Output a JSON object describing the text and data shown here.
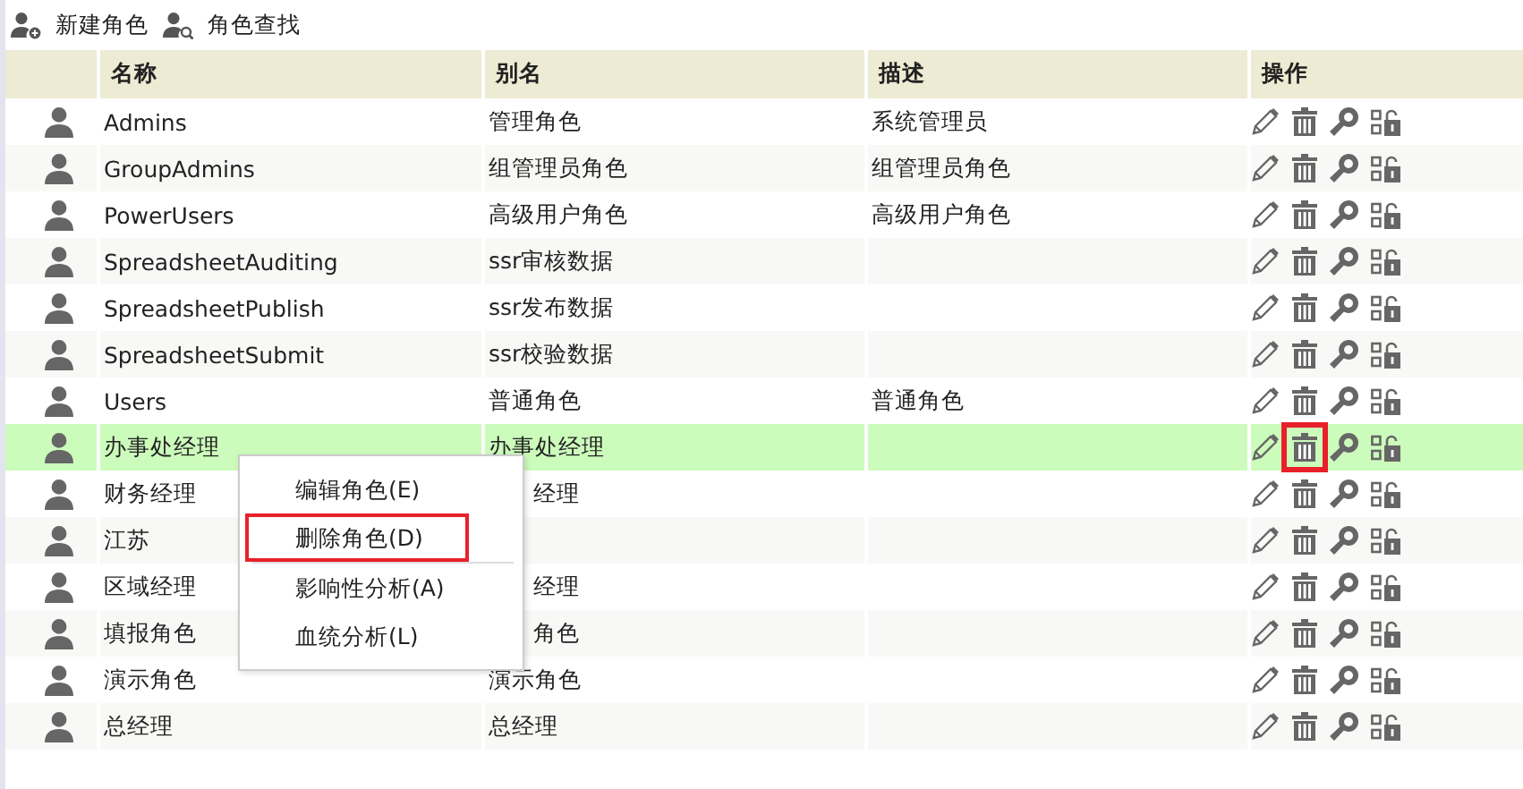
{
  "toolbar": [
    {
      "label": "新建角色",
      "kind": "add"
    },
    {
      "label": "角色查找",
      "kind": "find"
    }
  ],
  "table": {
    "columns": [
      "名称",
      "别名",
      "描述",
      "操作"
    ],
    "rows": [
      {
        "name": "Admins",
        "alias": "管理角色",
        "description": "系统管理员",
        "selected": false
      },
      {
        "name": "GroupAdmins",
        "alias": "组管理员角色",
        "description": "组管理员角色",
        "selected": false
      },
      {
        "name": "PowerUsers",
        "alias": "高级用户角色",
        "description": "高级用户角色",
        "selected": false
      },
      {
        "name": "SpreadsheetAuditing",
        "alias": "ssr审核数据",
        "selected": false
      },
      {
        "name": "SpreadsheetPublish",
        "alias": "ssr发布数据",
        "selected": false
      },
      {
        "name": "SpreadsheetSubmit",
        "alias": "ssr校验数据",
        "selected": false
      },
      {
        "name": "Users",
        "alias": "普通角色",
        "description": "普通角色",
        "selected": false
      },
      {
        "name": "办事处经理",
        "alias": "办事处经理",
        "selected": true,
        "delete_marked": true
      },
      {
        "name": "财务经理",
        "alias": "经理",
        "alias_cut": true,
        "selected": false
      },
      {
        "name": "江苏",
        "selected": false
      },
      {
        "name": "区域经理",
        "alias": "经理",
        "alias_cut": true,
        "selected": false
      },
      {
        "name": "填报角色",
        "alias": "角色",
        "alias_cut": true,
        "selected": false
      },
      {
        "name": "演示角色",
        "alias": "演示角色",
        "selected": false
      },
      {
        "name": "总经理",
        "alias": "总经理",
        "selected": false
      }
    ]
  },
  "context_menu": {
    "items": [
      {
        "label": "编辑角色(E)",
        "marked": false,
        "separator_after": false
      },
      {
        "label": "删除角色(D)",
        "marked": true,
        "separator_after": true
      },
      {
        "label": "影响性分析(A)",
        "marked": false,
        "separator_after": false
      },
      {
        "label": "血统分析(L)",
        "marked": false,
        "separator_after": false
      }
    ]
  }
}
